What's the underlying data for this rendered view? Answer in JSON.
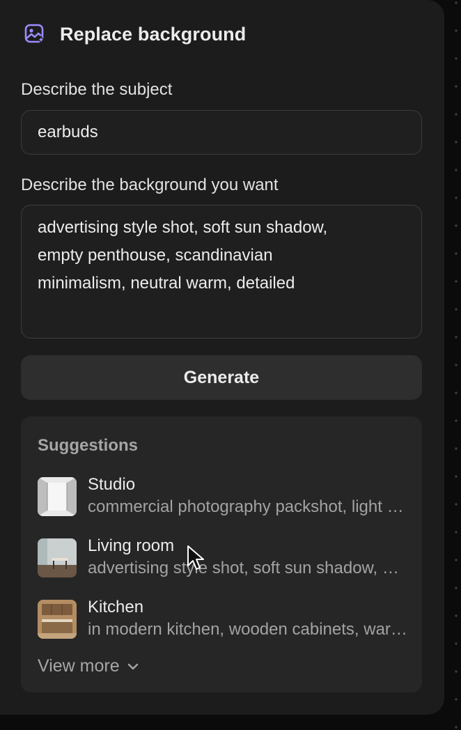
{
  "panel": {
    "title": "Replace background",
    "title_icon": "image-sparkle-icon",
    "accent_color": "#9b8cff"
  },
  "subject": {
    "label": "Describe the subject",
    "value": "earbuds"
  },
  "background": {
    "label": "Describe the background you want",
    "value": "advertising style shot, soft sun shadow,\nempty penthouse, scandinavian\nminimalism, neutral warm, detailed"
  },
  "generate_label": "Generate",
  "suggestions": {
    "title": "Suggestions",
    "items": [
      {
        "name": "Studio",
        "description": "commercial photography packshot, light studio background, minimal",
        "thumb": "studio-thumbnail"
      },
      {
        "name": "Living room",
        "description": "advertising style shot, soft sun shadow, empty penthouse",
        "thumb": "living-room-thumbnail"
      },
      {
        "name": "Kitchen",
        "description": "in modern kitchen, wooden cabinets, warm light",
        "thumb": "kitchen-thumbnail"
      }
    ],
    "view_more_label": "View more"
  }
}
